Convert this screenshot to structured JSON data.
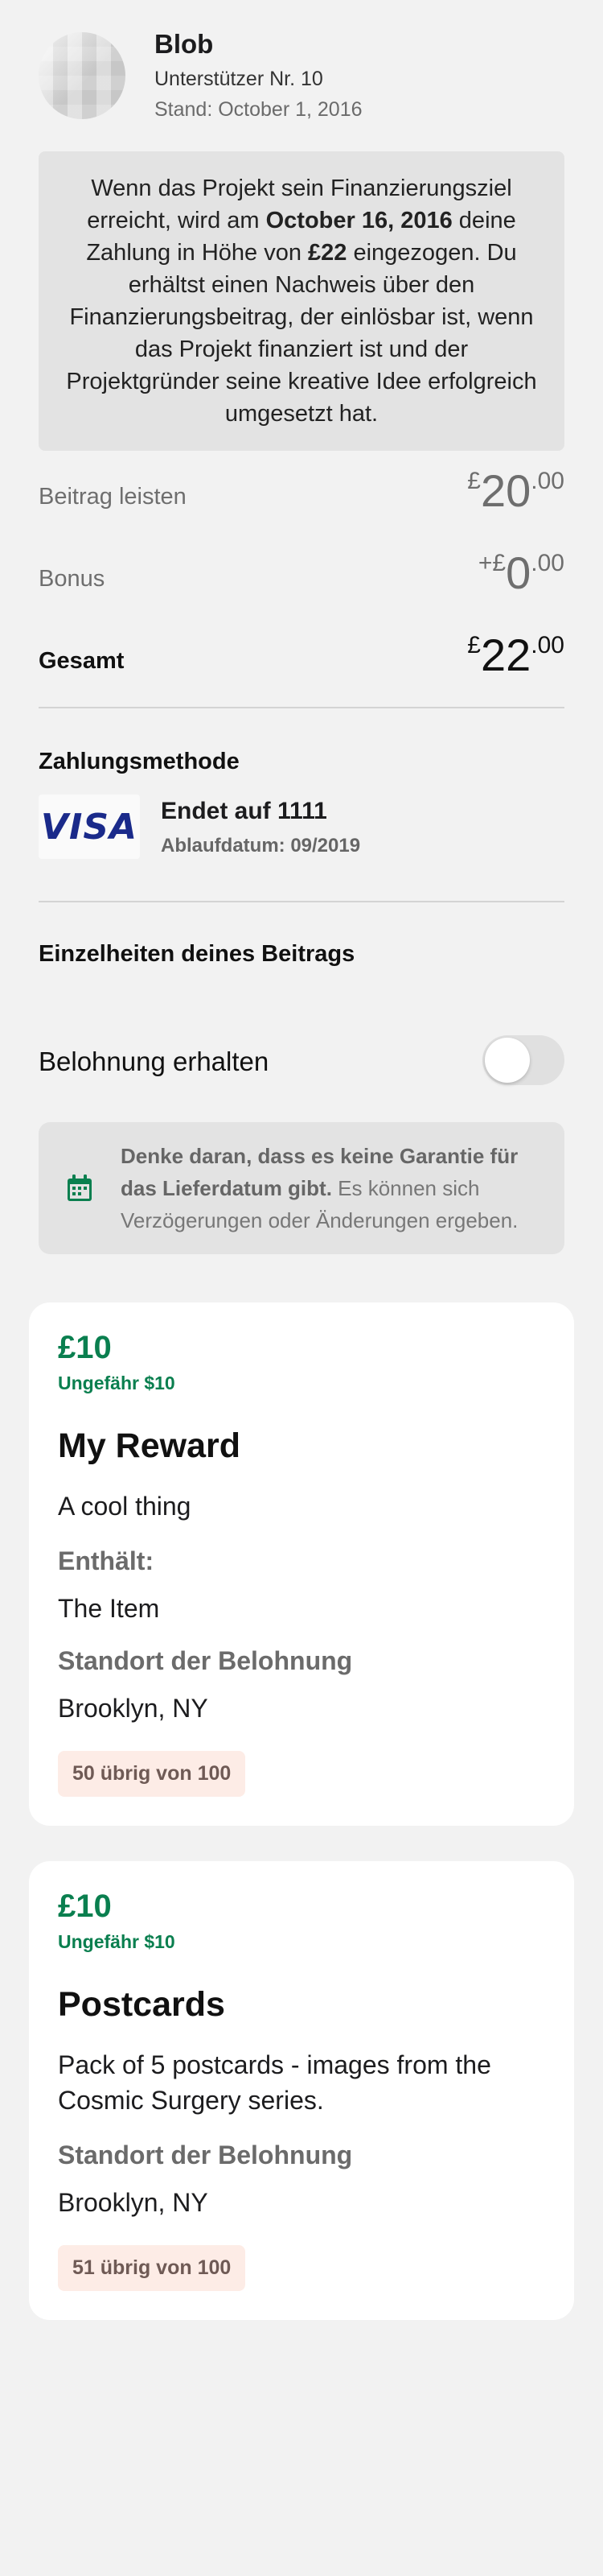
{
  "header": {
    "name": "Blob",
    "backer": "Unterstützer Nr. 10",
    "status_date": "Stand: October 1, 2016"
  },
  "info": {
    "p1": "Wenn das Projekt sein Finanzierungsziel erreicht, wird am ",
    "date": "October 16, 2016",
    "p2": " deine Zahlung in Höhe von ",
    "amount": "£22",
    "p3": " eingezogen. Du erhältst einen Nachweis über den Finanzierungsbeitrag, der einlösbar ist, wenn das Projekt finanziert ist und der Projektgründer seine kreative Idee erfolgreich umgesetzt hat."
  },
  "amounts": {
    "pledge": {
      "label": "Beitrag leisten",
      "prefix": "£",
      "whole": "20",
      "cents": ".00"
    },
    "bonus": {
      "label": "Bonus",
      "prefix": "+£",
      "whole": "0",
      "cents": ".00"
    },
    "total": {
      "label": "Gesamt",
      "prefix": "£",
      "whole": "22",
      "cents": ".00"
    }
  },
  "payment": {
    "title": "Zahlungsmethode",
    "brand": "VISA",
    "ends": "Endet auf 1111",
    "expires": "Ablaufdatum: 09/2019"
  },
  "details_title": "Einzelheiten deines Beitrags",
  "toggle": {
    "label": "Belohnung erhalten",
    "on": false
  },
  "notice": {
    "bold": "Denke daran, dass es keine Garantie für das Lieferdatum gibt.",
    "rest": " Es können sich Verzögerungen oder Änderungen ergeben."
  },
  "colors": {
    "accent_green": "#0a7f4f",
    "badge_bg": "#fdece6"
  },
  "rewards": [
    {
      "price": "£10",
      "approx": "Ungefähr $10",
      "title": "My Reward",
      "description": "A cool thing",
      "includes_label": "Enthält:",
      "includes_item": "The Item",
      "location_label": "Standort der Belohnung",
      "location": "Brooklyn, NY",
      "remaining": "50 übrig von 100"
    },
    {
      "price": "£10",
      "approx": "Ungefähr $10",
      "title": "Postcards",
      "description": "Pack of 5 postcards - images from the Cosmic Surgery series.",
      "location_label": "Standort der Belohnung",
      "location": "Brooklyn, NY",
      "remaining": "51 übrig von 100"
    }
  ]
}
